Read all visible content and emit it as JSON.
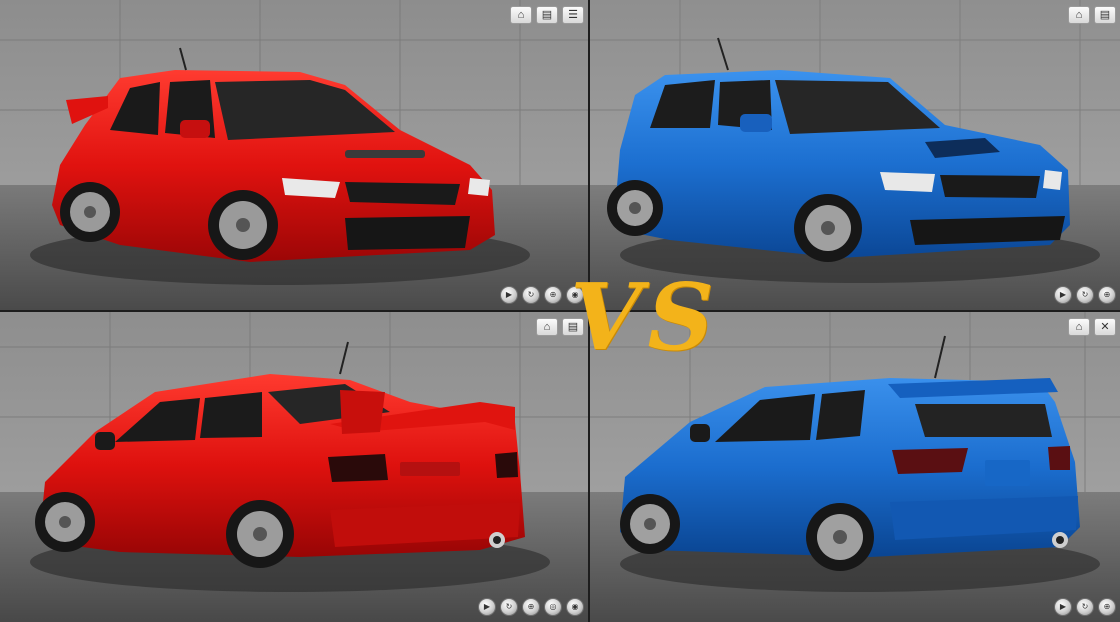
{
  "overlay": {
    "vs_text": "VS",
    "vs_color": "#f3b31a"
  },
  "panels": [
    {
      "id": "top-left",
      "car": "red sedan, front three-quarter view",
      "body_color": "#d81414",
      "toolbar_icons": [
        "home-icon",
        "layers-icon",
        "menu-icon"
      ],
      "control_icons": [
        "play-icon",
        "orbit-icon",
        "zoom-icon",
        "fullscreen-icon"
      ]
    },
    {
      "id": "top-right",
      "car": "blue hatchback, front three-quarter view",
      "body_color": "#1c6fd0",
      "toolbar_icons": [
        "home-icon",
        "layers-icon"
      ],
      "control_icons": [
        "play-icon",
        "orbit-icon",
        "zoom-icon"
      ]
    },
    {
      "id": "bottom-left",
      "car": "red sedan, rear three-quarter view",
      "body_color": "#d81414",
      "toolbar_icons": [
        "home-icon",
        "layers-icon"
      ],
      "control_icons": [
        "play-icon",
        "orbit-icon",
        "zoom-icon",
        "camera-icon",
        "fullscreen-icon"
      ]
    },
    {
      "id": "bottom-right",
      "car": "blue hatchback, rear three-quarter view",
      "body_color": "#1c6fd0",
      "toolbar_icons": [
        "home-icon",
        "close-icon"
      ],
      "control_icons": [
        "play-icon",
        "orbit-icon",
        "zoom-icon"
      ]
    }
  ]
}
